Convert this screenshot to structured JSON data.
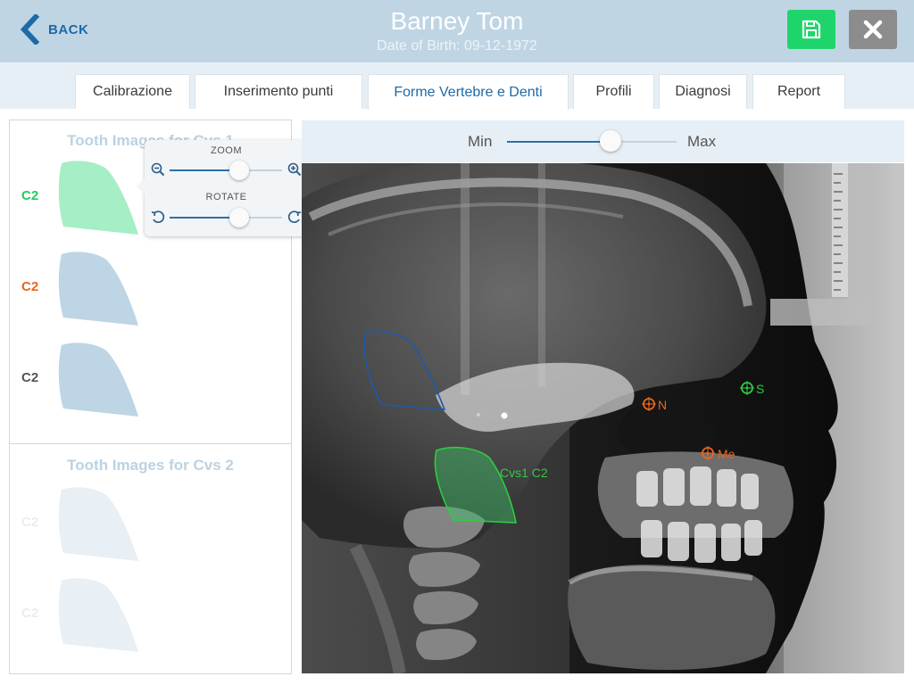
{
  "header": {
    "back_label": "BACK",
    "patient_name": "Barney Tom",
    "dob_label": "Date of Birth:",
    "dob_value": "09-12-1972",
    "save_icon": "floppy-disk-icon",
    "close_icon": "close-x-icon",
    "colors": {
      "header_bg": "#bfd5e4",
      "accent": "#1d6aa8",
      "save": "#1fd56b",
      "close": "#8c8c8c"
    }
  },
  "tabs": [
    {
      "label": "Calibrazione",
      "active": false
    },
    {
      "label": "Inserimento punti",
      "active": false
    },
    {
      "label": "Forme Vertebre e Denti",
      "active": true
    },
    {
      "label": "Profili",
      "active": false
    },
    {
      "label": "Diagnosi",
      "active": false
    },
    {
      "label": "Report",
      "active": false
    }
  ],
  "left_panel": {
    "cvs1": {
      "title": "Tooth Images for Cvs 1",
      "items": [
        {
          "label": "C2",
          "state": "selected",
          "color": "#1fcf5b"
        },
        {
          "label": "C2",
          "state": "active",
          "color": "#e8661d"
        },
        {
          "label": "C2",
          "state": "default",
          "color": "#555555"
        }
      ]
    },
    "cvs2": {
      "title": "Tooth Images for Cvs 2",
      "items": [
        {
          "label": "C2",
          "state": "disabled",
          "color": "#e8eef3"
        },
        {
          "label": "C2",
          "state": "disabled",
          "color": "#e8eef3"
        }
      ]
    }
  },
  "popover": {
    "zoom_label": "ZOOM",
    "rotate_label": "ROTATE",
    "zoom_value": 0.62,
    "rotate_value": 0.62,
    "icons": [
      "zoom-out-icon",
      "zoom-in-icon",
      "rotate-left-icon",
      "rotate-right-icon"
    ]
  },
  "contrast_slider": {
    "min_label": "Min",
    "max_label": "Max",
    "value": 0.61
  },
  "xray": {
    "landmarks": [
      {
        "label": "N",
        "color": "#e8661d"
      },
      {
        "label": "S",
        "color": "#2ecc40"
      },
      {
        "label": "Me",
        "color": "#e8661d"
      }
    ],
    "overlay_label": "Cvs1 C2",
    "overlay_color": "#2ecc40",
    "outline_color": "#1d5aa8"
  }
}
